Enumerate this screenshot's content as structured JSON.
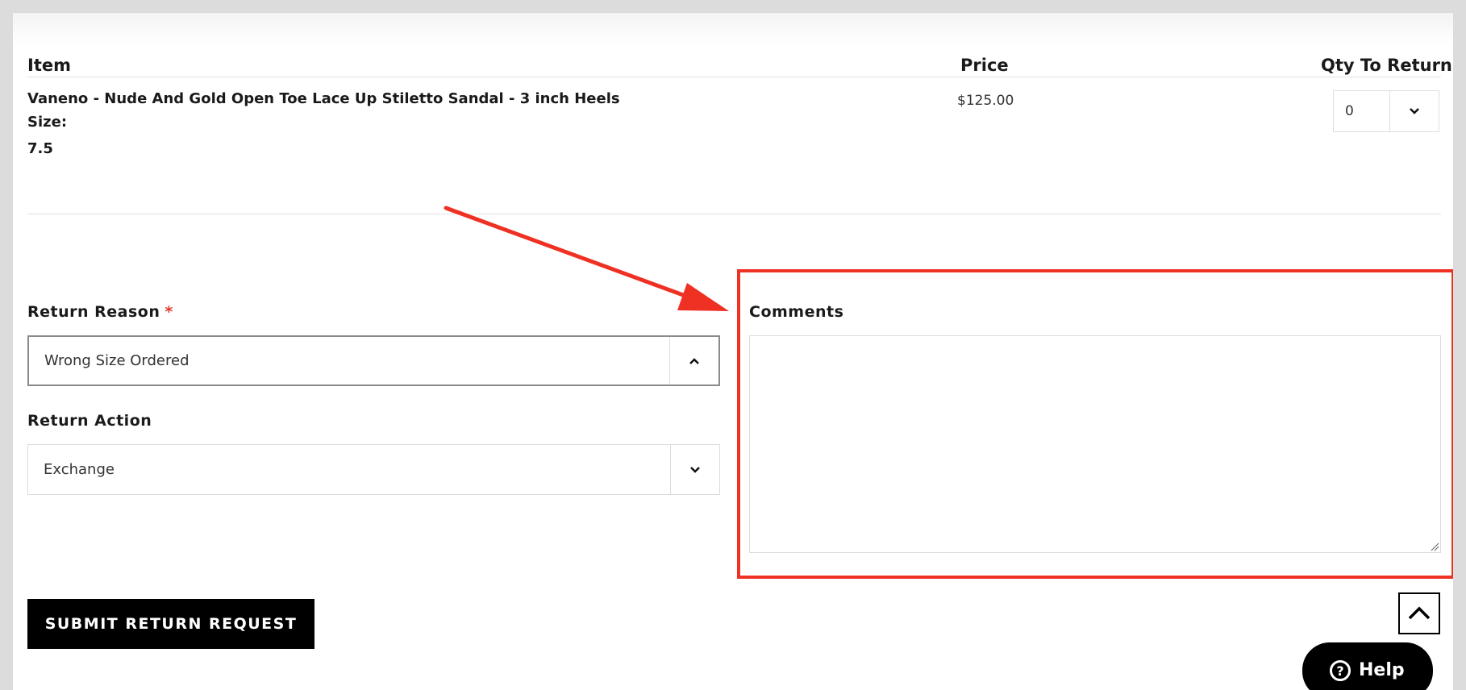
{
  "table": {
    "headers": {
      "item": "Item",
      "price": "Price",
      "qty": "Qty To Return"
    },
    "row": {
      "name": "Vaneno - Nude And Gold Open Toe Lace Up Stiletto Sandal - 3 inch Heels",
      "size_label": "Size:",
      "size_value": "7.5",
      "price": "$125.00",
      "qty_value": "0"
    }
  },
  "form": {
    "return_reason": {
      "label": "Return Reason",
      "required_mark": "*",
      "value": "Wrong Size Ordered"
    },
    "return_action": {
      "label": "Return Action",
      "value": "Exchange"
    },
    "comments": {
      "label": "Comments",
      "value": ""
    },
    "submit_label": "SUBMIT RETURN REQUEST"
  },
  "help_label": "Help",
  "icons": [
    "chevron-down-icon",
    "chevron-up-icon",
    "help-icon",
    "arrow-up-icon"
  ],
  "annotation": {
    "color": "#ef3124"
  }
}
